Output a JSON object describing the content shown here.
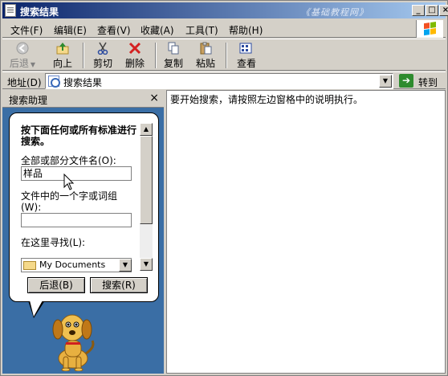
{
  "window": {
    "title": "搜索结果",
    "watermark": "《基础教程网》"
  },
  "menu": [
    "文件(F)",
    "编辑(E)",
    "查看(V)",
    "收藏(A)",
    "工具(T)",
    "帮助(H)"
  ],
  "toolbar": {
    "back": "后退",
    "up": "向上",
    "cut": "剪切",
    "delete": "删除",
    "copy": "复制",
    "paste": "粘贴",
    "view": "查看"
  },
  "address": {
    "label": "地址(D)",
    "value": "搜索结果",
    "go": "转到"
  },
  "search_panel": {
    "header": "搜索助理",
    "heading": "按下面任何或所有标准进行搜索。",
    "filename_label": "全部或部分文件名(O):",
    "filename_value": "样品",
    "word_label_1": "文件中的一个字或词组",
    "word_label_2": "(W):",
    "word_value": "",
    "lookin_label": "在这里寻找(L):",
    "lookin_value": "My Documents",
    "back_button": "后退(B)",
    "search_button": "搜索(R)"
  },
  "main": {
    "message": "要开始搜索，请按照左边窗格中的说明执行。"
  },
  "colors": {
    "title_start": "#0a246a",
    "title_end": "#a6caf0",
    "panel_bg": "#3a6ea5",
    "go_green": "#2e8b2e"
  }
}
